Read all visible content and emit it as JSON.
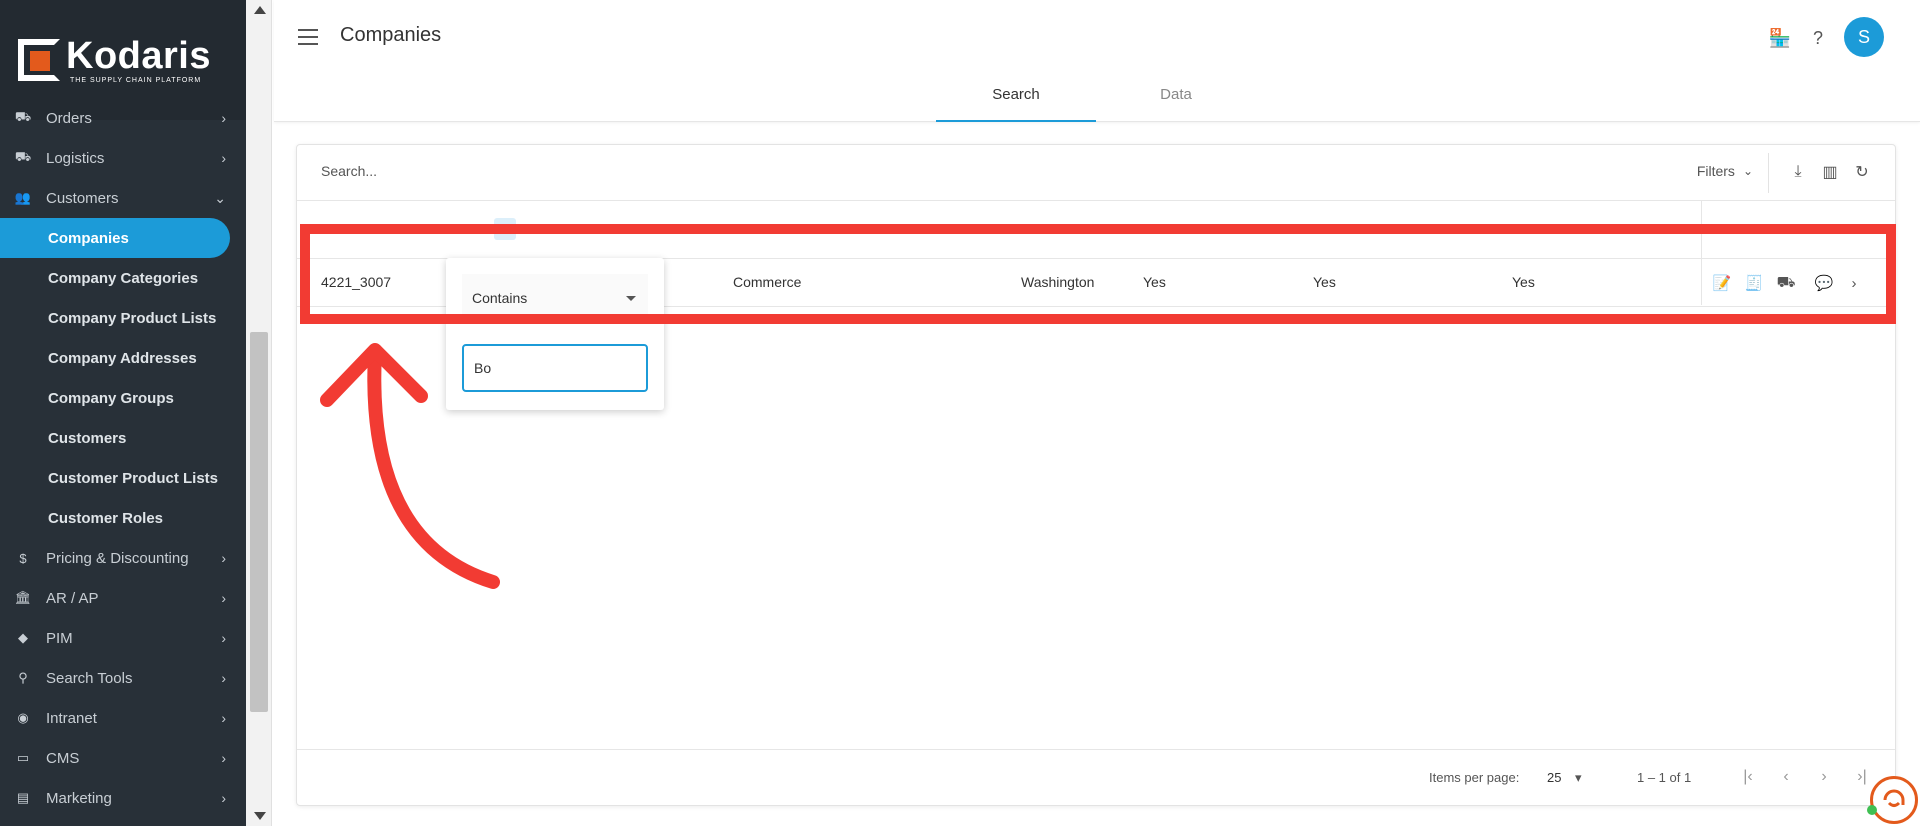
{
  "brand": {
    "name": "Kodaris",
    "tagline": "THE SUPPLY CHAIN PLATFORM"
  },
  "sidebar": {
    "items": [
      {
        "label": "Orders",
        "icon": "truck-icon",
        "expanded": false
      },
      {
        "label": "Logistics",
        "icon": "delivery-icon",
        "expanded": false
      },
      {
        "label": "Customers",
        "icon": "people-icon",
        "expanded": true,
        "children": [
          {
            "label": "Companies",
            "active": true
          },
          {
            "label": "Company Categories"
          },
          {
            "label": "Company Product Lists"
          },
          {
            "label": "Company Addresses"
          },
          {
            "label": "Company Groups"
          },
          {
            "label": "Customers"
          },
          {
            "label": "Customer Product Lists"
          },
          {
            "label": "Customer Roles"
          }
        ]
      },
      {
        "label": "Pricing & Discounting",
        "icon": "dollar-icon",
        "expanded": false
      },
      {
        "label": "AR / AP",
        "icon": "bank-icon",
        "expanded": false
      },
      {
        "label": "PIM",
        "icon": "tag-icon",
        "expanded": false
      },
      {
        "label": "Search Tools",
        "icon": "search-icon",
        "expanded": false
      },
      {
        "label": "Intranet",
        "icon": "globe-icon",
        "expanded": false
      },
      {
        "label": "CMS",
        "icon": "browser-icon",
        "expanded": false
      },
      {
        "label": "Marketing",
        "icon": "megaphone-icon",
        "expanded": false
      }
    ]
  },
  "header": {
    "title": "Companies",
    "avatar_initial": "S",
    "tabs": [
      {
        "label": "Search",
        "active": true
      },
      {
        "label": "Data",
        "active": false
      }
    ]
  },
  "search": {
    "placeholder": "Search...",
    "filters_label": "Filters"
  },
  "table": {
    "row": {
      "id": "4221_3007",
      "col3": "Commerce",
      "city": "Washington",
      "flag1": "Yes",
      "flag2": "Yes",
      "flag3": "Yes"
    }
  },
  "filter_popup": {
    "operator": "Contains",
    "value": "Bo"
  },
  "pagination": {
    "items_per_page_label": "Items per page:",
    "items_per_page": "25",
    "range": "1 – 1 of 1"
  },
  "colors": {
    "accent": "#1c9bd8",
    "sidebar_bg": "#283038",
    "highlight": "#f23b33",
    "brand_orange": "#e35a1c"
  }
}
